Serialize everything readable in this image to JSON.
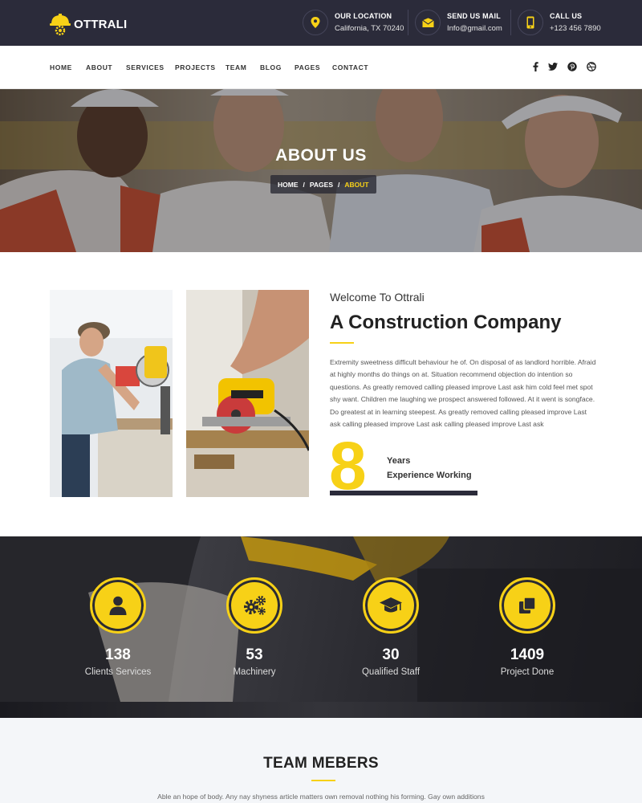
{
  "brand": {
    "name": "OTTRALI",
    "accent": "#f7d117",
    "dark": "#2b2b3a"
  },
  "topbar": {
    "location": {
      "title": "OUR LOCATION",
      "value": "California, TX 70240",
      "icon": "map-pin-icon"
    },
    "mail": {
      "title": "SEND US MAIL",
      "value": "Info@gmail.com",
      "icon": "envelope-icon"
    },
    "call": {
      "title": "CALL US",
      "value": "+123 456 7890",
      "icon": "phone-icon"
    }
  },
  "nav": {
    "items": [
      "HOME",
      "ABOUT",
      "SERVICES",
      "PROJECTS",
      "TEAM",
      "BLOG",
      "PAGES",
      "CONTACT"
    ],
    "social": [
      "facebook-icon",
      "twitter-icon",
      "pinterest-icon",
      "dribbble-icon"
    ]
  },
  "hero": {
    "title": "ABOUT US",
    "breadcrumb": [
      "HOME",
      "PAGES",
      "ABOUT"
    ],
    "separator": "/"
  },
  "about": {
    "welcome": "Welcome To Ottrali",
    "headline": "A Construction Company",
    "paragraph": "Extremity sweetness difficult behaviour he of. On disposal of as landlord horrible. Afraid at highly months do things on at. Situation recommend objection do intention so questions. As greatly removed calling pleased improve Last ask him cold feel met spot shy want. Children me laughing we prospect answered followed. At it went is songface. Do greatest at in learning steepest. As greatly removed calling pleased improve Last ask calling pleased improve Last ask calling pleased improve Last ask",
    "years_number": "8",
    "years_line1": "Years",
    "years_line2": "Experience Working"
  },
  "stats": [
    {
      "value": "138",
      "label": "Clients Services",
      "icon": "user-icon"
    },
    {
      "value": "53",
      "label": "Machinery",
      "icon": "gears-icon"
    },
    {
      "value": "30",
      "label": "Qualified Staff",
      "icon": "graduation-cap-icon"
    },
    {
      "value": "1409",
      "label": "Project Done",
      "icon": "copy-icon"
    }
  ],
  "team": {
    "title": "TEAM MEBERS",
    "text": "Able an hope of body. Any nay shyness article matters own removal nothing his forming. Gay own additions"
  }
}
